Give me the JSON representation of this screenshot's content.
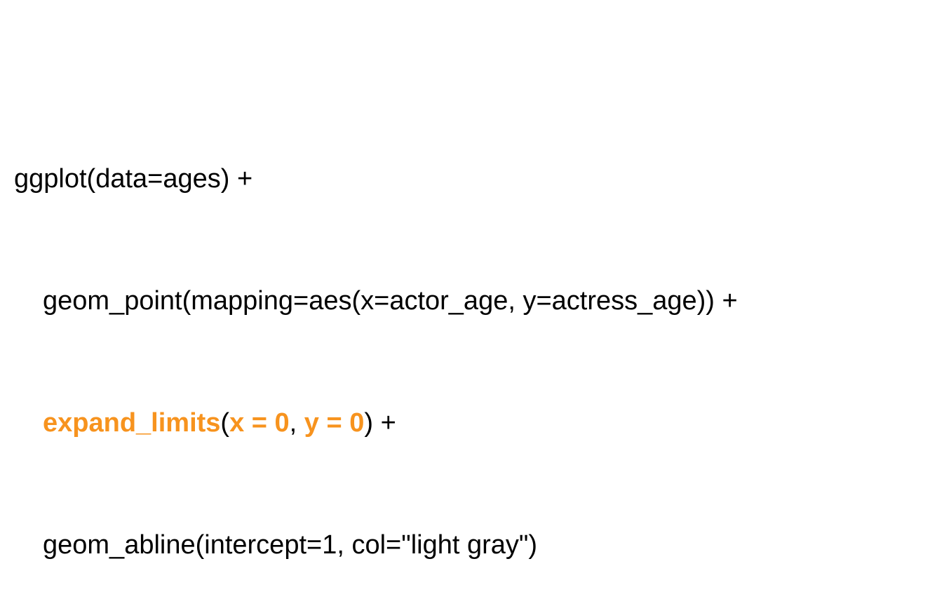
{
  "colors": {
    "text": "#000000",
    "highlight": "#f7931e",
    "background": "#ffffff"
  },
  "code": {
    "line1": "ggplot(data=ages) +",
    "line2": "geom_point(mapping=aes(x=actor_age, y=actress_age)) +",
    "line3": {
      "func": "expand_limits",
      "open": "(",
      "arg1": "x = 0",
      "sep": ", ",
      "arg2": "y = 0",
      "close": ") +"
    },
    "line4": "geom_abline(intercept=1, col=\"light gray\")"
  }
}
